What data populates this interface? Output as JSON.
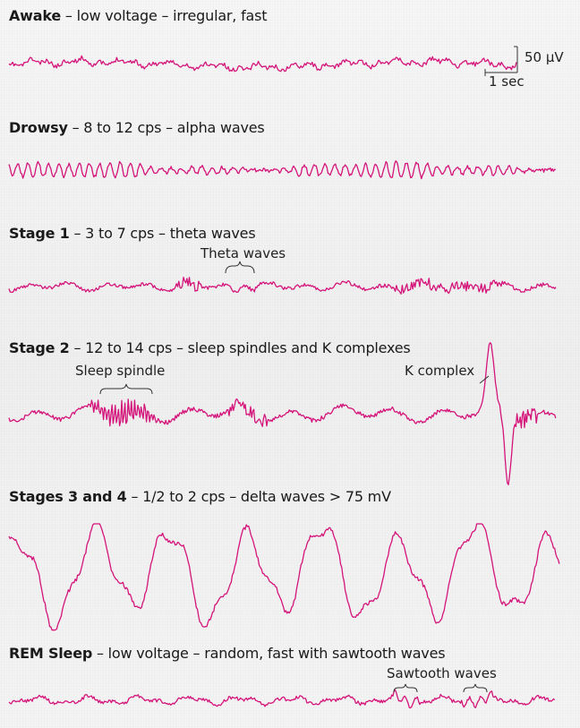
{
  "stages": [
    {
      "name": "Awake",
      "description": " – low voltage – irregular, fast"
    },
    {
      "name": "Drowsy",
      "description": " – 8 to 12 cps – alpha waves"
    },
    {
      "name": "Stage 1",
      "description": " – 3 to 7 cps – theta waves",
      "annotations": [
        "Theta waves"
      ]
    },
    {
      "name": "Stage 2",
      "description": " – 12 to 14 cps – sleep spindles and K complexes",
      "annotations": [
        "Sleep spindle",
        "K complex"
      ]
    },
    {
      "name": "Stages 3 and 4",
      "description": " – 1/2 to 2 cps – delta waves > 75 mV"
    },
    {
      "name": "REM Sleep",
      "description": " – low voltage – random, fast with sawtooth waves",
      "annotations": [
        "Sawtooth waves"
      ]
    }
  ],
  "scale_bar": {
    "voltage_label": "50 µV",
    "time_label": "1 sec"
  },
  "colors": {
    "trace": "#d4147a",
    "text": "#1a1a1a"
  }
}
